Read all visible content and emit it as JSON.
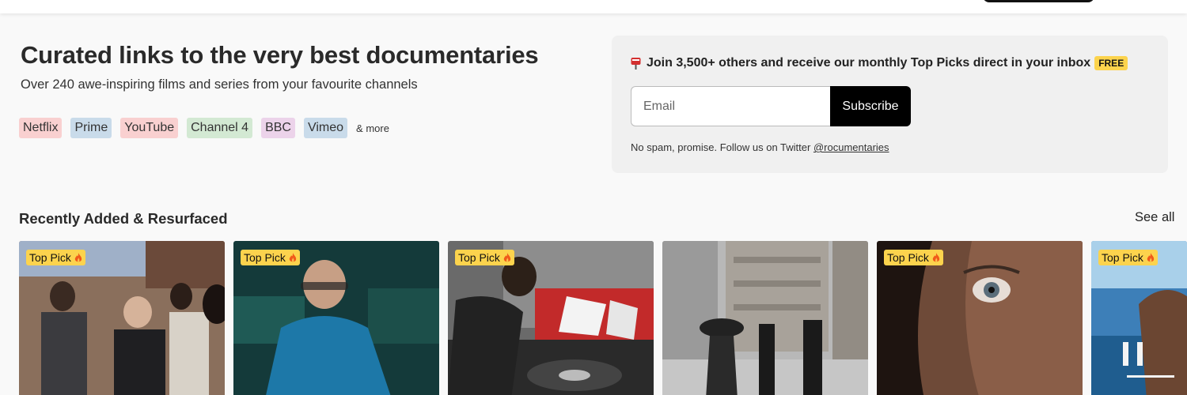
{
  "hero": {
    "title": "Curated links to the very best documentaries",
    "subtitle": "Over 240 awe-inspiring films and series from your favourite channels",
    "chips": [
      {
        "label": "Netflix",
        "color": "#f9d0d0"
      },
      {
        "label": "Prime",
        "color": "#c9dbea"
      },
      {
        "label": "YouTube",
        "color": "#f9d0d0"
      },
      {
        "label": "Channel 4",
        "color": "#d3e9d3"
      },
      {
        "label": "BBC",
        "color": "#ecd3ea"
      },
      {
        "label": "Vimeo",
        "color": "#c9dbea"
      }
    ],
    "more_label": "& more"
  },
  "newsletter": {
    "title": "Join 3,500+ others and receive our monthly Top Picks direct in your inbox",
    "badge": "FREE",
    "email_placeholder": "Email",
    "subscribe_label": "Subscribe",
    "footer_text": "No spam, promise. Follow us on Twitter ",
    "twitter_handle": "@rocumentaries"
  },
  "section": {
    "title": "Recently Added & Resurfaced",
    "see_all": "See all",
    "top_pick_label": "Top Pick",
    "cards": [
      {
        "top_pick": true
      },
      {
        "top_pick": true
      },
      {
        "top_pick": true
      },
      {
        "top_pick": false
      },
      {
        "top_pick": true
      },
      {
        "top_pick": true
      }
    ]
  },
  "colors": {
    "accent_badge": "#fcd34d",
    "button": "#000000",
    "panel": "#f0f0f0"
  }
}
